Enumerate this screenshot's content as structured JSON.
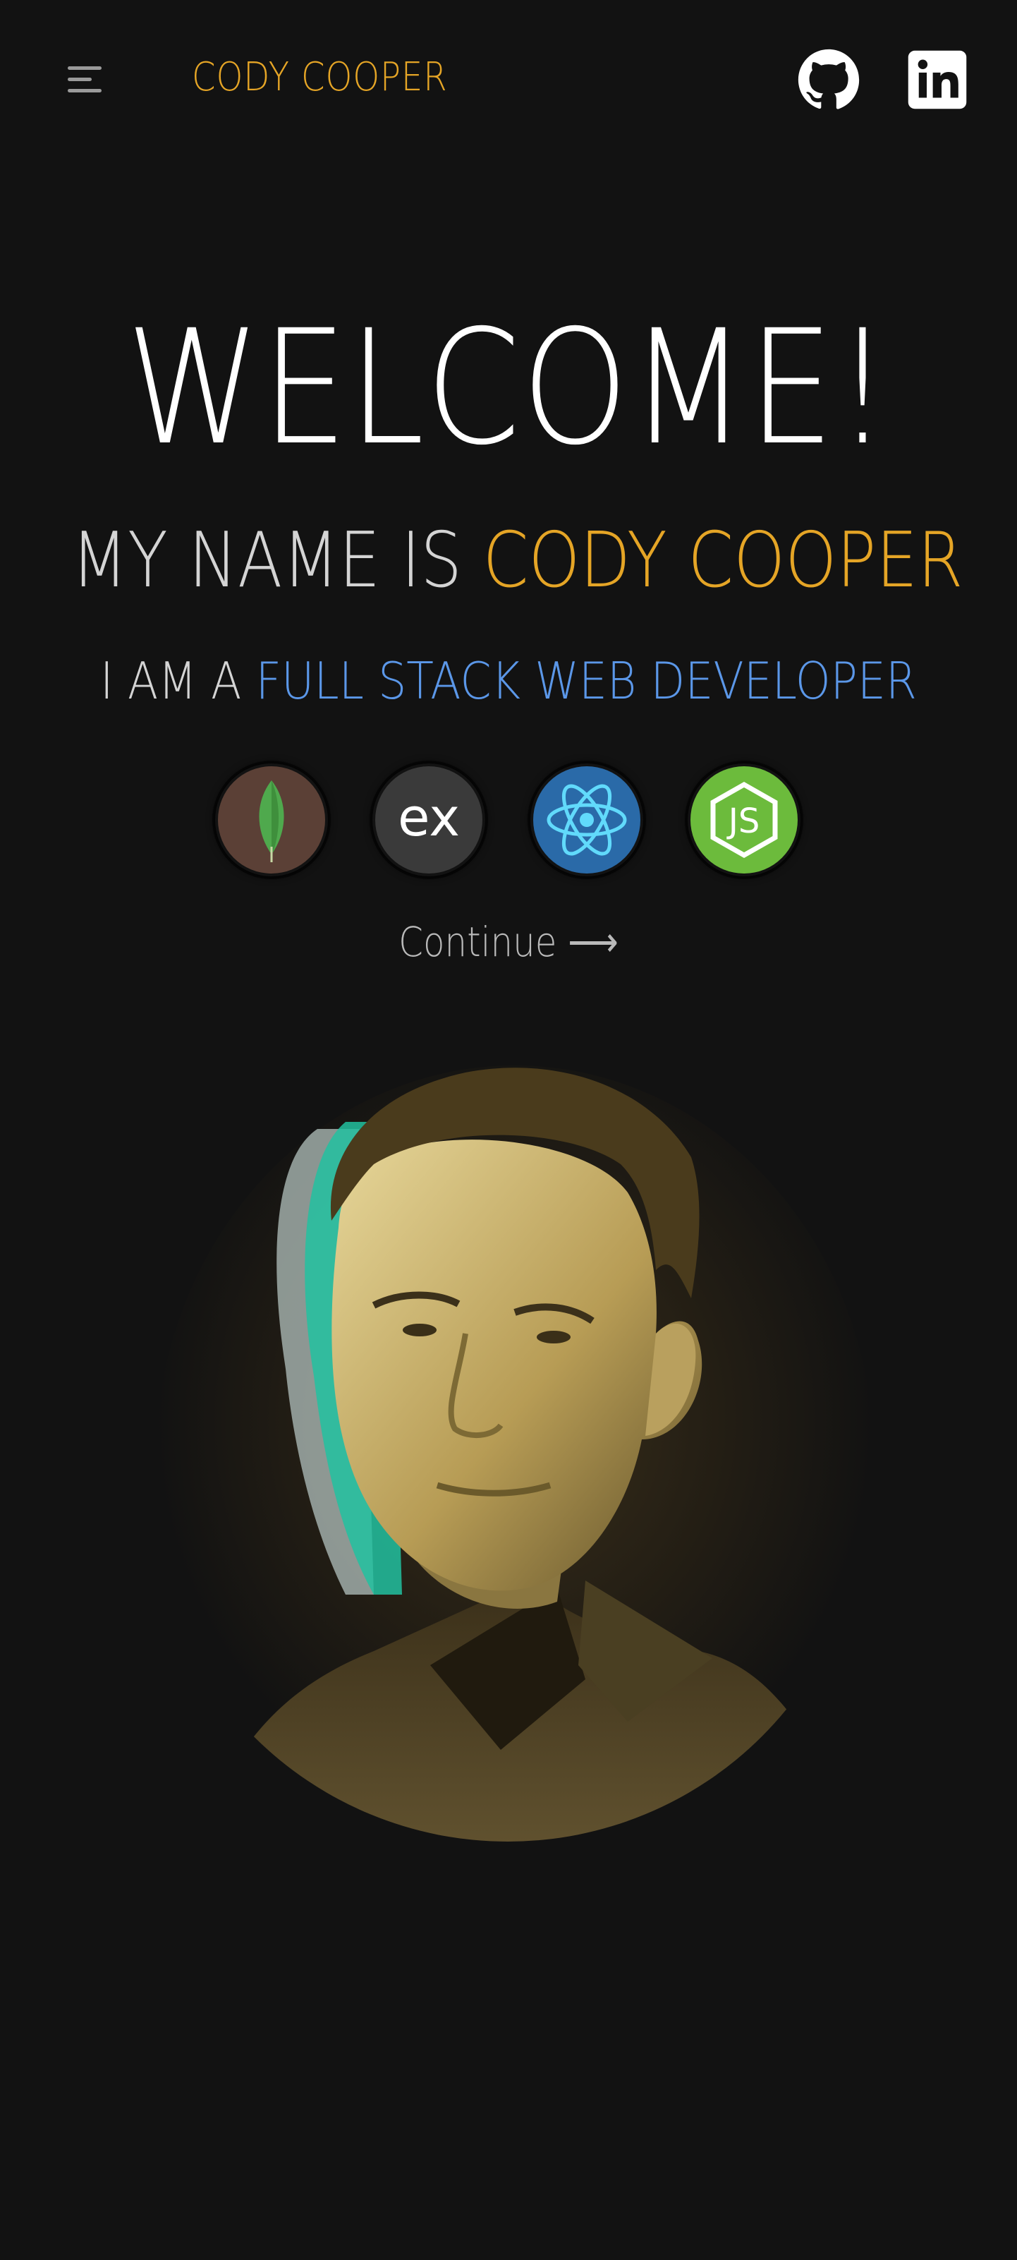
{
  "header": {
    "brand": "CODY COOPER",
    "menu_icon": "hamburger-menu-icon",
    "social": [
      {
        "name": "GitHub",
        "icon": "github-icon"
      },
      {
        "name": "LinkedIn",
        "icon": "linkedin-icon"
      }
    ]
  },
  "hero": {
    "welcome": "WELCOME!",
    "name_prefix": "MY NAME IS ",
    "name": "CODY COOPER",
    "role_prefix": "I AM A ",
    "role": "FULL STACK WEB DEVELOPER",
    "continue_label": "Continue ⟶"
  },
  "tech_stack": [
    {
      "icon": "mongodb-icon",
      "color": "#4fa94d"
    },
    {
      "icon": "express-icon",
      "label": "ex",
      "color": "#ffffff"
    },
    {
      "icon": "react-icon",
      "color": "#61dafb"
    },
    {
      "icon": "nodejs-icon",
      "label": "JS",
      "color": "#6cbb3c"
    }
  ],
  "colors": {
    "background": "#121212",
    "accent_gold": "#e5a526",
    "accent_blue": "#5b97e8",
    "text": "#d4d4d4"
  }
}
